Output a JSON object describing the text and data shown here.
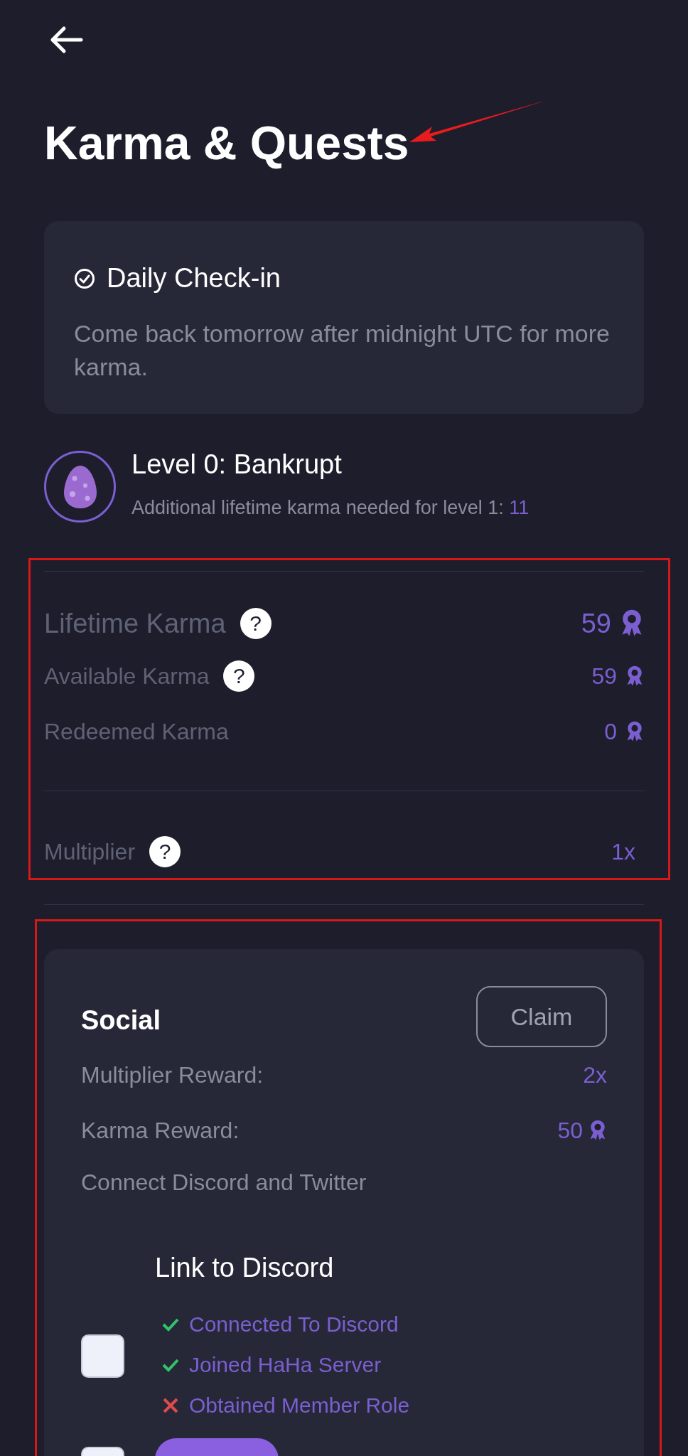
{
  "header": {
    "title": "Karma & Quests"
  },
  "daily_checkin": {
    "title": "Daily Check-in",
    "message": "Come back tomorrow after midnight UTC for more karma."
  },
  "level": {
    "title": "Level 0: Bankrupt",
    "subtitle": "Additional lifetime karma needed for level 1: ",
    "needed": "11"
  },
  "stats": [
    {
      "label": "Lifetime Karma",
      "value": "59",
      "help": "?",
      "kind": "primary"
    },
    {
      "label": "Available Karma",
      "value": "59",
      "help": "?",
      "kind": "secondary"
    },
    {
      "label": "Redeemed Karma",
      "value": "0",
      "kind": "secondary"
    }
  ],
  "multiplier": {
    "label": "Multiplier",
    "help": "?",
    "value": "1x"
  },
  "quest": {
    "title": "Social",
    "button": "Claim",
    "rewards": [
      {
        "label": "Multiplier Reward:",
        "value": "2x",
        "kind": "multiplier"
      },
      {
        "label": "Karma Reward:",
        "value": "50",
        "kind": "karma"
      }
    ],
    "description": "Connect Discord and Twitter",
    "task": {
      "title": "Link to Discord",
      "checked": false,
      "steps": [
        {
          "label": "Connected To Discord",
          "done": true
        },
        {
          "label": "Joined HaHa Server",
          "done": true
        },
        {
          "label": "Obtained Member Role",
          "done": false
        }
      ]
    },
    "next_task": {
      "checked": false
    }
  },
  "annotations": [
    {
      "kind": "arrow"
    },
    {
      "kind": "box"
    },
    {
      "kind": "box"
    }
  ]
}
